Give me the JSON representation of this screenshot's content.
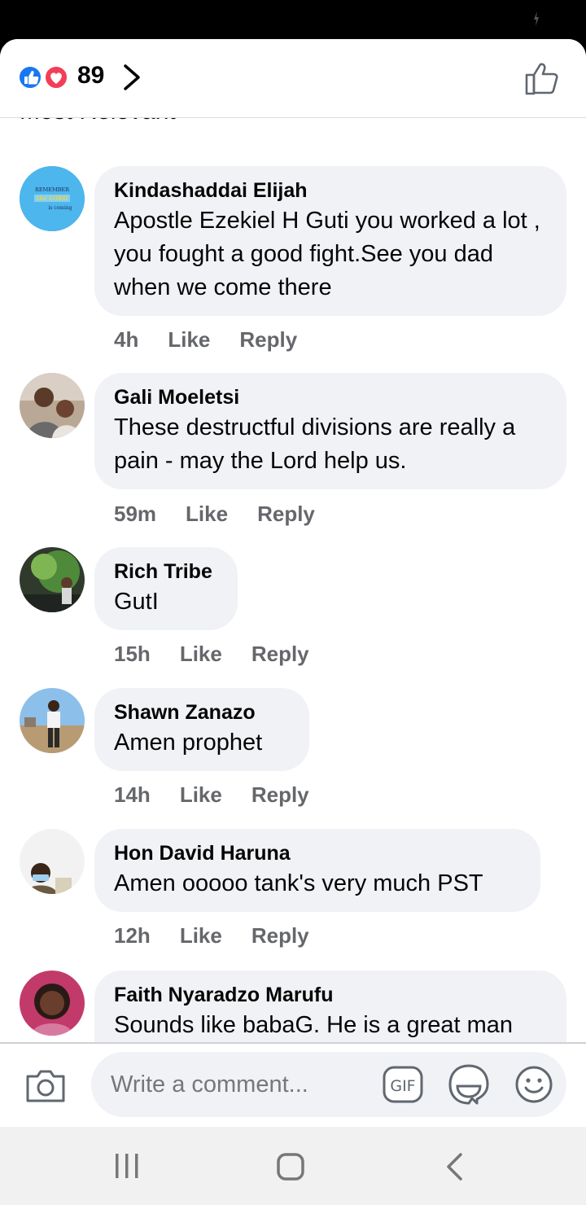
{
  "header": {
    "reaction_count": "89",
    "reaction_icons": [
      "like-reaction-icon",
      "love-reaction-icon"
    ],
    "sort_label": "Most Relevant"
  },
  "comments": [
    {
      "author": "Kindashaddai Elijah",
      "text": "Apostle Ezekiel H Guti you worked a lot , you fought a good fight.See you dad when we come there",
      "time": "4h",
      "like": "Like",
      "reply": "Reply",
      "avatar_text": [
        "REMEMBER",
        "the LORD",
        "is coming"
      ]
    },
    {
      "author": "Gali Moeletsi",
      "text": "These destructful divisions are really a pain - may the Lord help us.",
      "time": "59m",
      "like": "Like",
      "reply": "Reply"
    },
    {
      "author": "Rich Tribe",
      "text": "GutI",
      "time": "15h",
      "like": "Like",
      "reply": "Reply"
    },
    {
      "author": "Shawn Zanazo",
      "text": "Amen prophet",
      "time": "14h",
      "like": "Like",
      "reply": "Reply"
    },
    {
      "author": "Hon David Haruna",
      "text": "Amen ooooo tank's very much PST",
      "time": "12h",
      "like": "Like",
      "reply": "Reply"
    },
    {
      "author": "Faith Nyaradzo Marufu",
      "text": "Sounds like babaG. He is a great man"
    }
  ],
  "composer": {
    "placeholder": "Write a comment...",
    "gif_label": "GIF"
  },
  "colors": {
    "bubble": "#f0f2f5",
    "meta_text": "#65676b",
    "like_blue": "#1877f2",
    "love_red": "#f33e58"
  }
}
